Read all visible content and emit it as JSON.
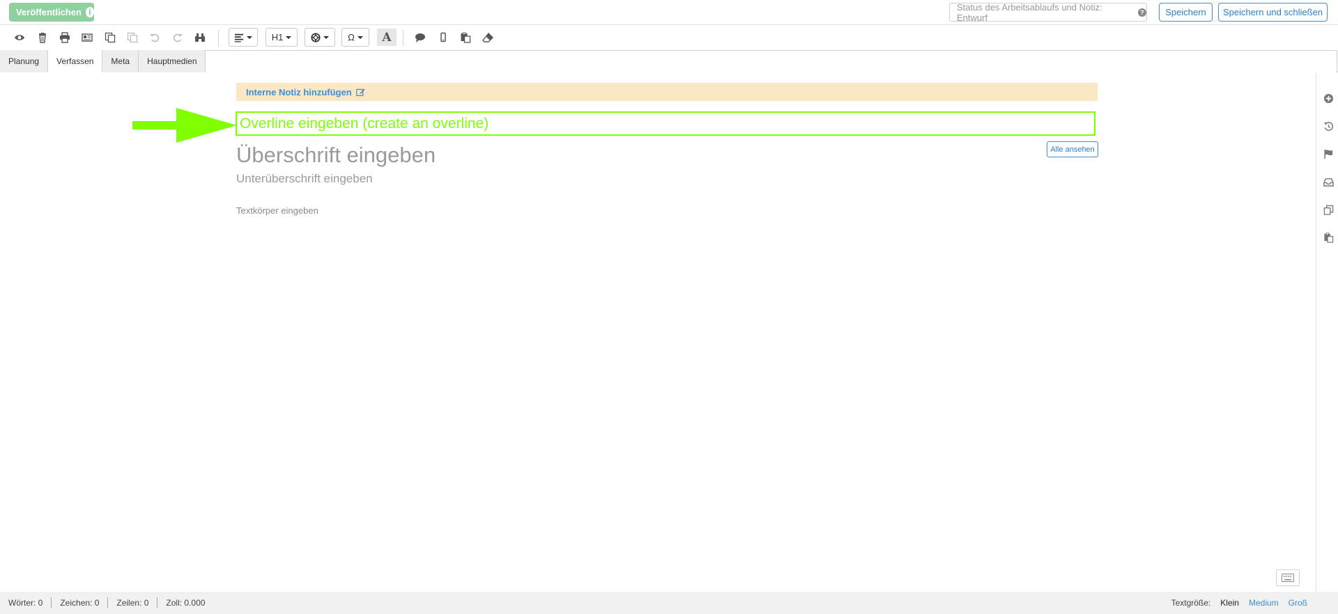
{
  "topbar": {
    "publish_label": "Veröffentlichen",
    "info_glyph": "i",
    "status_label": "Status des Arbeitsablaufs und Notiz: Entwurf",
    "save_label": "Speichern",
    "save_close_label": "Speichern und schließen"
  },
  "toolbar": {
    "icons": [
      "preview-icon",
      "trash-icon",
      "print-icon",
      "newspaper-icon",
      "copy-icon",
      "paste-icon",
      "undo-icon",
      "redo-icon",
      "find-icon",
      "comment-icon",
      "mobile-icon",
      "clipboard-icon",
      "eraser-icon"
    ],
    "heading_label": "H1",
    "omega_label": "Ω",
    "font_label": "A"
  },
  "tabs": [
    {
      "label": "Planung"
    },
    {
      "label": "Verfassen",
      "active": true
    },
    {
      "label": "Meta"
    },
    {
      "label": "Hauptmedien"
    }
  ],
  "editor": {
    "note_label": "Interne Notiz hinzufügen",
    "overline_placeholder": "Overline eingeben (create an overline)",
    "headline_placeholder": "Überschrift eingeben",
    "subheadline_placeholder": "Unterüberschrift eingeben",
    "body_placeholder": "Textkörper eingeben",
    "view_all_label": "Alle ansehen",
    "annotation_color": "#7fff00"
  },
  "right_rail": {
    "icons": [
      "add-icon",
      "history-icon",
      "flag-icon",
      "inbox-icon",
      "copy-doc-icon",
      "paste-doc-icon"
    ]
  },
  "statusbar": {
    "words": "Wörter: 0",
    "chars": "Zeichen: 0",
    "lines": "Zeilen: 0",
    "inches": "Zoll: 0.000",
    "textsize_label": "Textgröße:",
    "size_small": "Klein",
    "size_medium": "Medium",
    "size_large": "Groß"
  }
}
